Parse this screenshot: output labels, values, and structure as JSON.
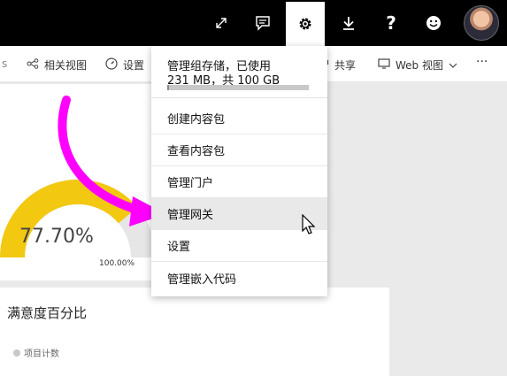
{
  "topbar": {
    "icons": [
      "expand-icon",
      "comment-icon",
      "gear-icon",
      "download-icon",
      "help-icon",
      "smiley-icon"
    ],
    "help_label": "?"
  },
  "subbar": {
    "related_view": "相关视图",
    "settings": "设置",
    "share": "共享",
    "web_view": "Web 视图",
    "more": "···"
  },
  "menu": {
    "storage_line1": "管理组存储，已使用",
    "storage_line2": "231 MB，共 100 GB",
    "storage_used_fraction": 0.0023,
    "items": [
      {
        "label": "创建内容包"
      },
      {
        "label": "查看内容包"
      },
      {
        "label": "管理门户"
      },
      {
        "label": "管理网关"
      },
      {
        "label": "设置"
      },
      {
        "label": "管理嵌入代码"
      }
    ],
    "hovered_index": 3
  },
  "report": {
    "gauge_value": "77.70%",
    "gauge_max": "100.00%",
    "card_title": "满意度百分比",
    "legend_item": "项目计数"
  },
  "colors": {
    "gauge_fill": "#F2C811",
    "gauge_track": "#E6E6E6",
    "arrow": "#FF00FF",
    "topbar": "#000000"
  }
}
